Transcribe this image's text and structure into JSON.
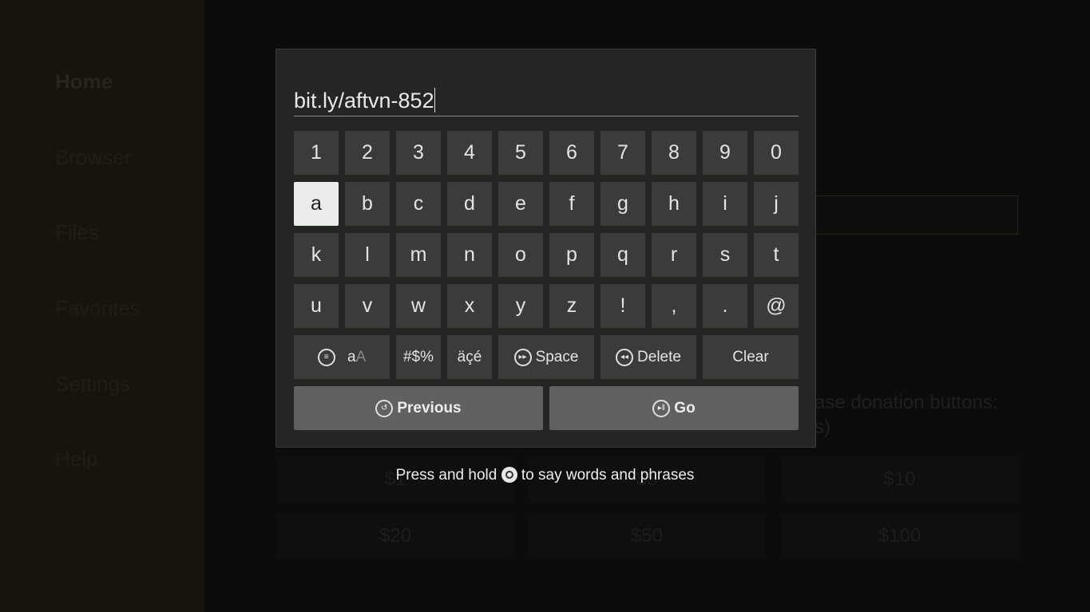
{
  "sidebar": {
    "items": [
      {
        "label": "Home",
        "active": true
      },
      {
        "label": "Browser"
      },
      {
        "label": "Files"
      },
      {
        "label": "Favorites"
      },
      {
        "label": "Settings"
      },
      {
        "label": "Help"
      }
    ]
  },
  "background": {
    "donation_text": "ase donation buttons:",
    "donation_text_2": "s)",
    "amounts": [
      "$1",
      "$5",
      "$10",
      "$20",
      "$50",
      "$100"
    ]
  },
  "keyboard": {
    "input_value": "bit.ly/aftvn-852",
    "rows": [
      [
        "1",
        "2",
        "3",
        "4",
        "5",
        "6",
        "7",
        "8",
        "9",
        "0"
      ],
      [
        "a",
        "b",
        "c",
        "d",
        "e",
        "f",
        "g",
        "h",
        "i",
        "j"
      ],
      [
        "k",
        "l",
        "m",
        "n",
        "o",
        "p",
        "q",
        "r",
        "s",
        "t"
      ],
      [
        "u",
        "v",
        "w",
        "x",
        "y",
        "z",
        "!",
        ",",
        ".",
        "@"
      ]
    ],
    "selected_key": "a",
    "case_toggle": {
      "lower": "a",
      "upper": "A",
      "icon": "menu-icon"
    },
    "symbols_label": "#$%",
    "accents_label": "äçé",
    "space_label": "Space",
    "space_icon": "fast-forward-icon",
    "delete_label": "Delete",
    "delete_icon": "rewind-icon",
    "clear_label": "Clear",
    "previous_label": "Previous",
    "previous_icon": "back-icon",
    "go_label": "Go",
    "go_icon": "play-pause-icon"
  },
  "hint": {
    "before": "Press and hold",
    "after": "to say words and phrases",
    "icon": "microphone-button-icon"
  }
}
